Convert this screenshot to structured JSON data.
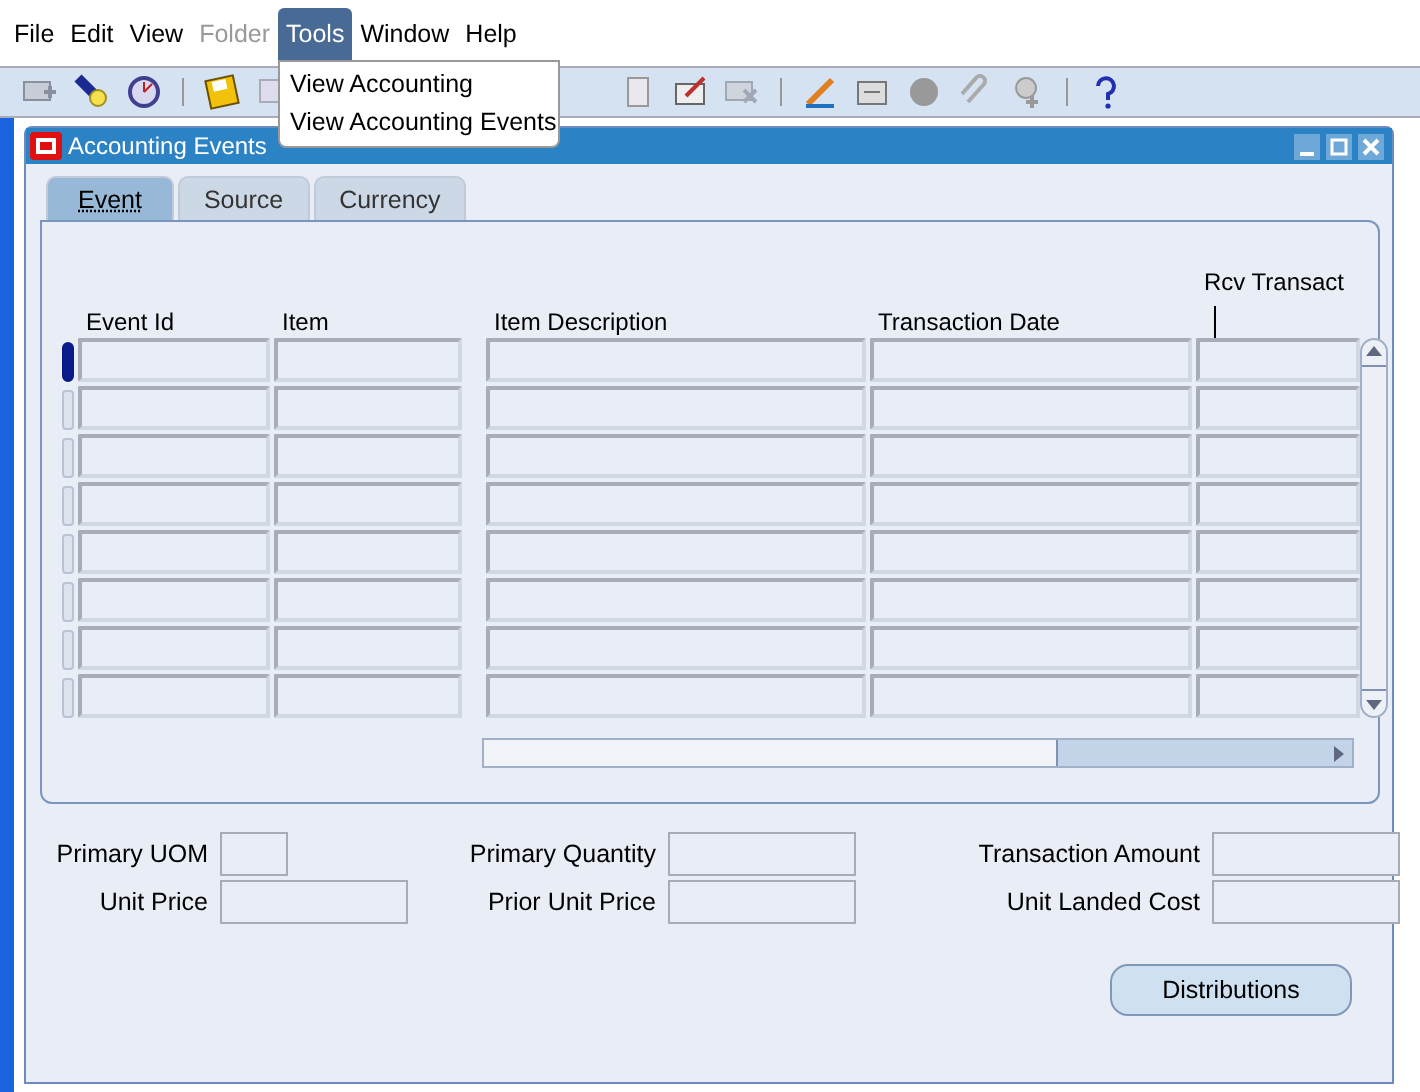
{
  "menu_bar": [
    {
      "label": "File",
      "disabled": false,
      "selected": false
    },
    {
      "label": "Edit",
      "disabled": false,
      "selected": false
    },
    {
      "label": "View",
      "disabled": false,
      "selected": false
    },
    {
      "label": "Folder",
      "disabled": true,
      "selected": false
    },
    {
      "label": "Tools",
      "disabled": false,
      "selected": true
    },
    {
      "label": "Window",
      "disabled": false,
      "selected": false
    },
    {
      "label": "Help",
      "disabled": false,
      "selected": false
    }
  ],
  "tools_menu": {
    "items": [
      "View Accounting",
      "View Accounting Events"
    ]
  },
  "window": {
    "title": "Accounting Events"
  },
  "tabs": [
    {
      "label": "Event",
      "selected": true
    },
    {
      "label": "Source",
      "selected": false
    },
    {
      "label": "Currency",
      "selected": false
    }
  ],
  "table": {
    "columns": [
      "Event Id",
      "Item",
      "Item Description",
      "Transaction Date",
      "Rcv Transact"
    ],
    "rows": [
      {
        "selected": true
      },
      {
        "selected": false
      },
      {
        "selected": false
      },
      {
        "selected": false
      },
      {
        "selected": false
      },
      {
        "selected": false
      },
      {
        "selected": false
      },
      {
        "selected": false
      }
    ]
  },
  "fields": [
    {
      "label": "Primary UOM",
      "kind": "short"
    },
    {
      "label": "Primary Quantity",
      "kind": "long"
    },
    {
      "label": "Transaction Amount",
      "kind": "long"
    },
    {
      "label": "Unit Price",
      "kind": "long"
    },
    {
      "label": "Prior Unit Price",
      "kind": "long"
    },
    {
      "label": "Unit Landed Cost",
      "kind": "long"
    }
  ],
  "buttons": [
    "Distributions"
  ]
}
